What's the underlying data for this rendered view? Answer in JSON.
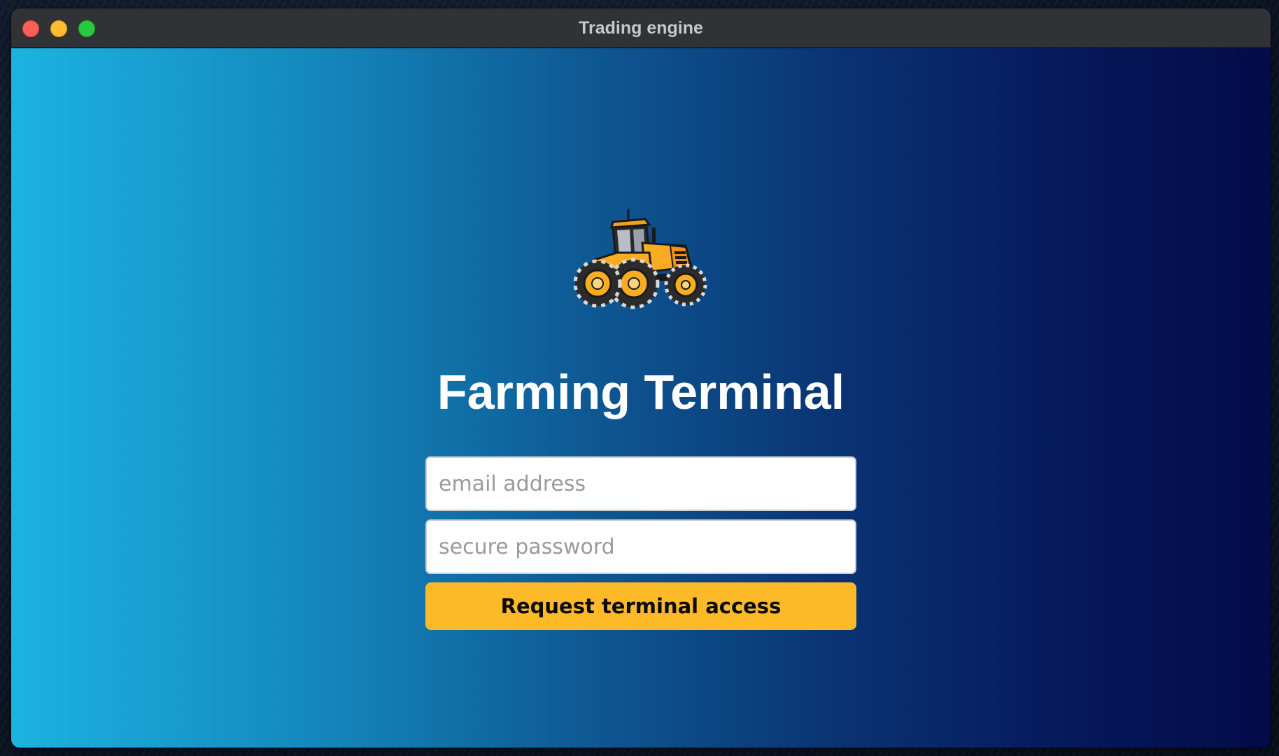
{
  "window": {
    "title": "Trading engine"
  },
  "app": {
    "logo_icon": "tractor-icon",
    "title": "Farming Terminal"
  },
  "form": {
    "email_placeholder": "email address",
    "email_value": "",
    "password_placeholder": "secure password",
    "password_value": "",
    "submit_label": "Request terminal access"
  },
  "colors": {
    "accent": "#fcb928",
    "gradient_start": "#1cb3e1",
    "gradient_end": "#030b48",
    "title_text": "#ffffff"
  }
}
